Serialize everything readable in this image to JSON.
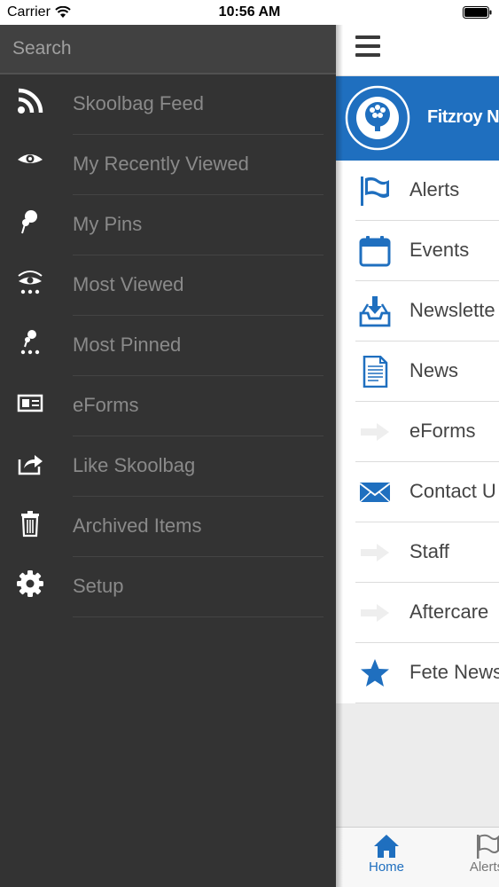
{
  "status_bar": {
    "carrier": "Carrier",
    "time": "10:56 AM"
  },
  "drawer": {
    "search_placeholder": "Search",
    "items": [
      {
        "label": "Skoolbag Feed",
        "icon": "rss-icon"
      },
      {
        "label": "My Recently Viewed",
        "icon": "eye-icon"
      },
      {
        "label": "My Pins",
        "icon": "pin-icon"
      },
      {
        "label": "Most Viewed",
        "icon": "most-viewed-icon"
      },
      {
        "label": "Most Pinned",
        "icon": "most-pinned-icon"
      },
      {
        "label": "eForms",
        "icon": "id-card-icon"
      },
      {
        "label": "Like Skoolbag",
        "icon": "share-icon"
      },
      {
        "label": "Archived Items",
        "icon": "trash-icon"
      },
      {
        "label": "Setup",
        "icon": "gear-icon"
      }
    ]
  },
  "main": {
    "school_name": "Fitzroy No",
    "items": [
      {
        "label": "Alerts",
        "icon": "flag-icon"
      },
      {
        "label": "Events",
        "icon": "calendar-icon"
      },
      {
        "label": "Newslette",
        "icon": "inbox-download-icon"
      },
      {
        "label": "News",
        "icon": "document-icon"
      },
      {
        "label": "eForms",
        "icon": "arrow-icon"
      },
      {
        "label": "Contact U",
        "icon": "envelope-icon"
      },
      {
        "label": "Staff",
        "icon": "arrow-icon"
      },
      {
        "label": "Aftercare",
        "icon": "arrow-icon"
      },
      {
        "label": "Fete News",
        "icon": "star-icon"
      }
    ],
    "tabs": [
      {
        "label": "Home",
        "icon": "home-icon",
        "active": true
      },
      {
        "label": "Alerts",
        "icon": "flag-icon",
        "active": false
      }
    ]
  },
  "colors": {
    "brand_blue": "#1f6fbf",
    "drawer_bg": "#333333",
    "tab_active": "#1f6fbf"
  }
}
